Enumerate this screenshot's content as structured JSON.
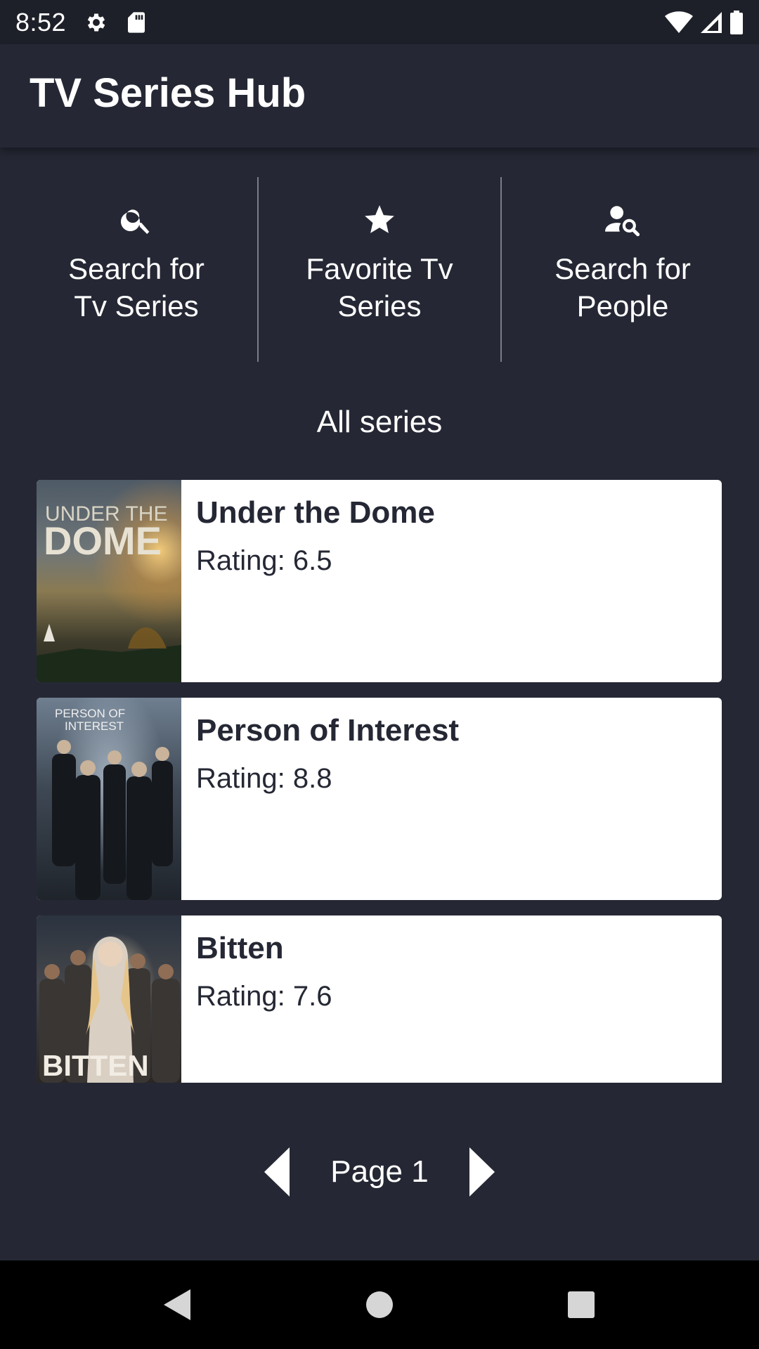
{
  "status_bar": {
    "time": "8:52",
    "icons": [
      "gear-icon",
      "sd-card-icon",
      "wifi-icon",
      "cell-signal-icon",
      "battery-icon"
    ]
  },
  "app_bar": {
    "title": "TV Series Hub"
  },
  "quick_actions": [
    {
      "label": "Search for\nTv Series",
      "icon": "search-icon"
    },
    {
      "label": "Favorite Tv\nSeries",
      "icon": "star-icon"
    },
    {
      "label": "Search for\nPeople",
      "icon": "person-search-icon"
    }
  ],
  "section": {
    "title": "All series"
  },
  "series": [
    {
      "title": "Under the Dome",
      "rating": "Rating: 6.5",
      "poster_text": [
        "UNDER THE",
        "DOME"
      ]
    },
    {
      "title": "Person of Interest",
      "rating": "Rating: 8.8",
      "poster_text": [
        "PERSON OF",
        "INTEREST"
      ]
    },
    {
      "title": "Bitten",
      "rating": "Rating: 7.6",
      "poster_text": [
        "BITTEN"
      ]
    }
  ],
  "pagination": {
    "label": "Page 1",
    "prev_icon": "triangle-left-icon",
    "next_icon": "triangle-right-icon"
  },
  "nav_bar": {
    "icons": [
      "back-icon",
      "home-icon",
      "recents-icon"
    ]
  },
  "colors": {
    "background": "#252834",
    "status_bar": "#1e2029",
    "card": "#ffffff",
    "card_text": "#252834",
    "divider": "#7a7d88"
  }
}
